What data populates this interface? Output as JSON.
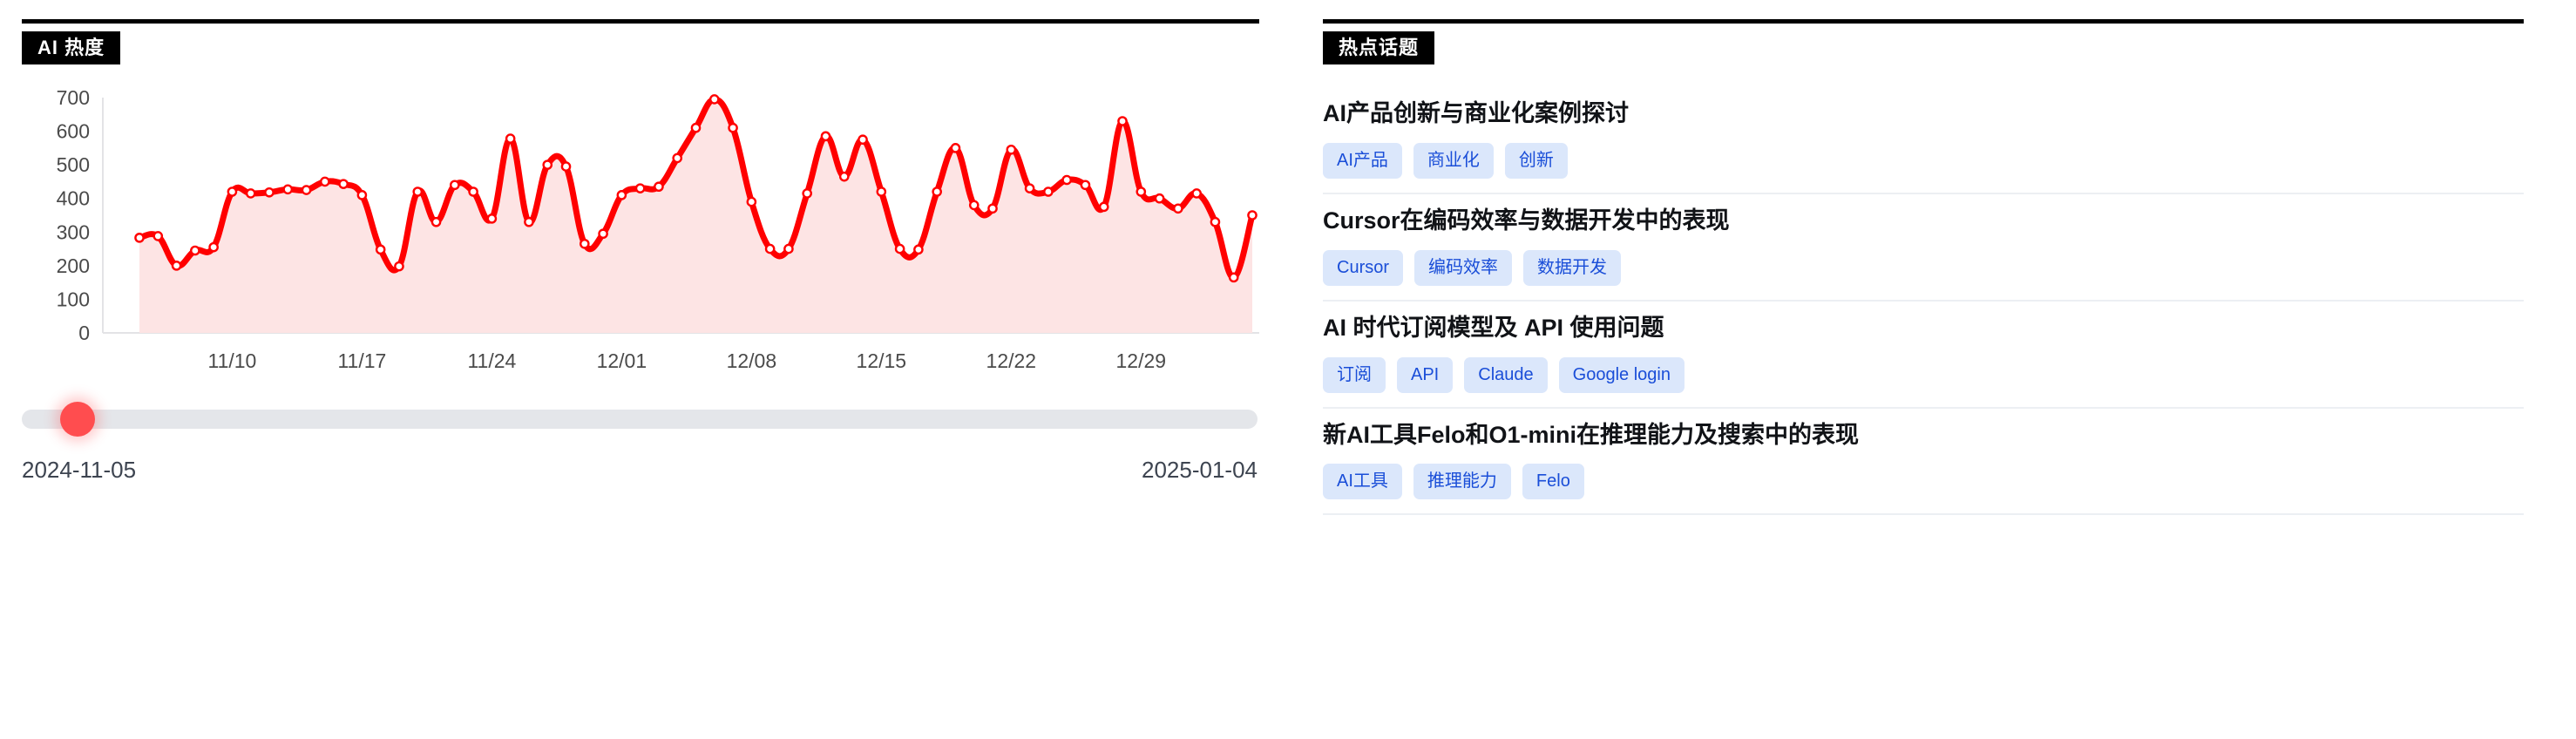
{
  "left_panel": {
    "title": "AI  热度",
    "slider": {
      "start_date": "2024-11-05",
      "end_date": "2025-01-04",
      "thumb_percent": 4.5
    }
  },
  "right_panel": {
    "title": "热点话题",
    "topics": [
      {
        "title": "AI产品创新与商业化案例探讨",
        "tags": [
          "AI产品",
          "商业化",
          "创新"
        ]
      },
      {
        "title": "Cursor在编码效率与数据开发中的表现",
        "tags": [
          "Cursor",
          "编码效率",
          "数据开发"
        ]
      },
      {
        "title": "AI 时代订阅模型及 API 使用问题",
        "tags": [
          "订阅",
          "API",
          "Claude",
          "Google login"
        ]
      },
      {
        "title": "新AI工具Felo和O1-mini在推理能力及搜索中的表现",
        "tags": [
          "AI工具",
          "推理能力",
          "Felo"
        ]
      }
    ]
  },
  "colors": {
    "line": "#ff0000",
    "area": "#fde4e4",
    "slider_thumb": "#ff4d4f",
    "slider_track": "#e4e6ea",
    "tag_bg": "#dbe7fb",
    "tag_text": "#1a4ed8",
    "panel_rule": "#000000"
  },
  "chart_data": {
    "type": "area",
    "title": "AI  热度",
    "xlabel": "",
    "ylabel": "",
    "ylim": [
      0,
      700
    ],
    "yticks": [
      0,
      100,
      200,
      300,
      400,
      500,
      600,
      700
    ],
    "grid": false,
    "legend": "none",
    "xtick_labels": [
      "11/10",
      "11/17",
      "11/24",
      "12/01",
      "12/08",
      "12/15",
      "12/22",
      "12/29"
    ],
    "xtick_indices": [
      5,
      12,
      19,
      26,
      33,
      40,
      47,
      54
    ],
    "x": [
      "11/05",
      "11/06",
      "11/07",
      "11/08",
      "11/09",
      "11/10",
      "11/11",
      "11/12",
      "11/13",
      "11/14",
      "11/15",
      "11/16",
      "11/17",
      "11/18",
      "11/19",
      "11/20",
      "11/21",
      "11/22",
      "11/23",
      "11/24",
      "11/25",
      "11/26",
      "11/27",
      "11/28",
      "11/29",
      "11/30",
      "12/01",
      "12/02",
      "12/03",
      "12/04",
      "12/05",
      "12/06",
      "12/07",
      "12/08",
      "12/09",
      "12/10",
      "12/11",
      "12/12",
      "12/13",
      "12/14",
      "12/15",
      "12/16",
      "12/17",
      "12/18",
      "12/19",
      "12/20",
      "12/21",
      "12/22",
      "12/23",
      "12/24",
      "12/25",
      "12/26",
      "12/27",
      "12/28",
      "12/29",
      "12/30",
      "12/31",
      "01/01",
      "01/02",
      "01/03",
      "01/04"
    ],
    "values": [
      283,
      288,
      200,
      245,
      255,
      420,
      415,
      418,
      427,
      425,
      450,
      443,
      410,
      248,
      198,
      420,
      330,
      440,
      420,
      340,
      578,
      330,
      500,
      495,
      265,
      295,
      410,
      430,
      435,
      520,
      610,
      695,
      610,
      390,
      250,
      250,
      415,
      585,
      465,
      575,
      420,
      250,
      248,
      420,
      550,
      380,
      370,
      545,
      430,
      420,
      455,
      440,
      375,
      630,
      420,
      400,
      370,
      415,
      330,
      165,
      350
    ],
    "series": [
      {
        "name": "AI 热度",
        "values": [
          283,
          288,
          200,
          245,
          255,
          420,
          415,
          418,
          427,
          425,
          450,
          443,
          410,
          248,
          198,
          420,
          330,
          440,
          420,
          340,
          578,
          330,
          500,
          495,
          265,
          295,
          410,
          430,
          435,
          520,
          610,
          695,
          610,
          390,
          250,
          250,
          415,
          585,
          465,
          575,
          420,
          250,
          248,
          420,
          550,
          380,
          370,
          545,
          430,
          420,
          455,
          440,
          375,
          630,
          420,
          400,
          370,
          415,
          330,
          165,
          350
        ]
      }
    ]
  }
}
